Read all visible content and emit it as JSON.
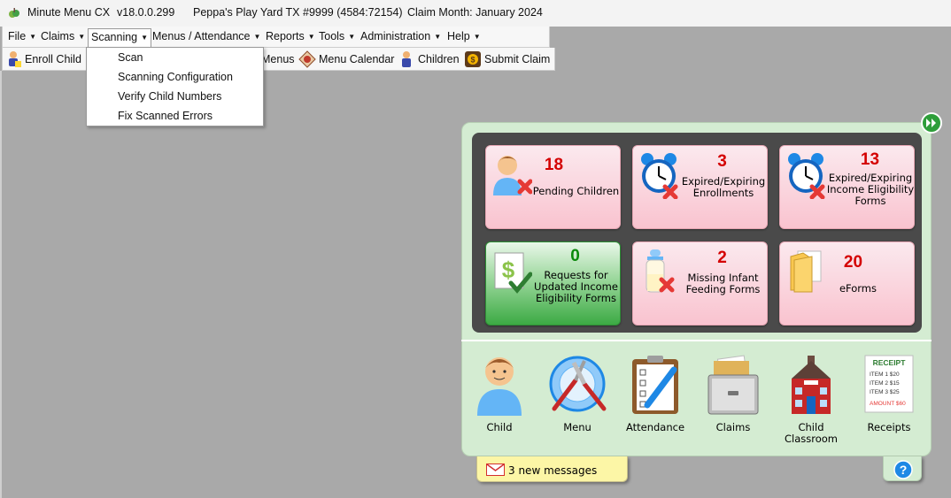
{
  "window": {
    "app_name": "Minute Menu CX",
    "version": "v18.0.0.299",
    "site": "Peppa's Play Yard TX #9999 (4584:72154)",
    "claim_month": "Claim Month: January 2024"
  },
  "menubar": {
    "items": [
      {
        "label": "File"
      },
      {
        "label": "Claims"
      },
      {
        "label": "Scanning"
      },
      {
        "label": "Menus / Attendance"
      },
      {
        "label": "Reports"
      },
      {
        "label": "Tools"
      },
      {
        "label": "Administration"
      },
      {
        "label": "Help"
      }
    ]
  },
  "scanning_menu": {
    "items": [
      {
        "label": "Scan"
      },
      {
        "label": "Scanning Configuration"
      },
      {
        "label": "Verify Child Numbers"
      },
      {
        "label": "Fix Scanned Errors"
      }
    ]
  },
  "toolbar": {
    "enroll_child": "Enroll Child",
    "menus": "Menus",
    "menu_calendar": "Menu Calendar",
    "children": "Children",
    "submit_claim": "Submit Claim"
  },
  "dashboard": {
    "tiles": [
      {
        "count": "18",
        "label": "Pending Children",
        "icon": "child-remove-icon",
        "color": "pink"
      },
      {
        "count": "3",
        "label": "Expired/Expiring Enrollments",
        "icon": "alarm-clock-icon",
        "color": "pink"
      },
      {
        "count": "13",
        "label": "Expired/Expiring Income Eligibility Forms",
        "icon": "alarm-clock-icon",
        "color": "pink"
      },
      {
        "count": "0",
        "label": "Requests for Updated Income Eligibility Forms",
        "icon": "money-doc-icon",
        "color": "green"
      },
      {
        "count": "2",
        "label": "Missing Infant Feeding Forms",
        "icon": "baby-bottle-icon",
        "color": "pink"
      },
      {
        "count": "20",
        "label": "eForms",
        "icon": "folder-icon",
        "color": "pink"
      }
    ]
  },
  "shortcuts": {
    "child": "Child",
    "menu": "Menu",
    "attendance": "Attendance",
    "claims": "Claims",
    "child_classroom": "Child Classroom",
    "receipts": "Receipts",
    "receipt_icon_text": {
      "title": "RECEIPT",
      "line1": "ITEM 1 $20",
      "line2": "ITEM 2 $15",
      "line3": "ITEM 3 $25",
      "amount": "AMOUNT $60"
    }
  },
  "messages": {
    "text": "3 new messages"
  },
  "colors": {
    "background": "#a9a9a9",
    "panel": "#d4ecd2",
    "dash": "#4a4a4a",
    "count_red": "#d40000",
    "count_green": "#0a8a0a"
  }
}
